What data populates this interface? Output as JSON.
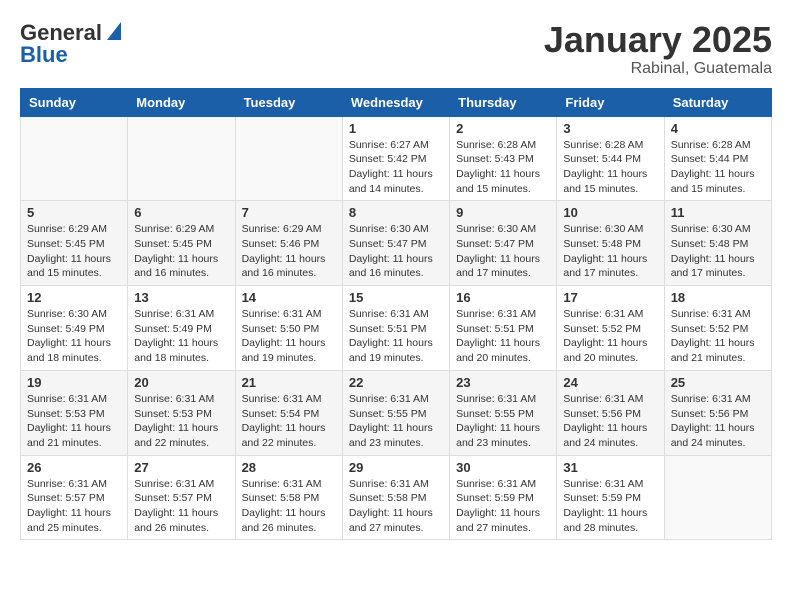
{
  "header": {
    "logo_general": "General",
    "logo_blue": "Blue",
    "month_title": "January 2025",
    "location": "Rabinal, Guatemala"
  },
  "weekdays": [
    "Sunday",
    "Monday",
    "Tuesday",
    "Wednesday",
    "Thursday",
    "Friday",
    "Saturday"
  ],
  "weeks": [
    [
      {
        "day": "",
        "info": ""
      },
      {
        "day": "",
        "info": ""
      },
      {
        "day": "",
        "info": ""
      },
      {
        "day": "1",
        "info": "Sunrise: 6:27 AM\nSunset: 5:42 PM\nDaylight: 11 hours\nand 14 minutes."
      },
      {
        "day": "2",
        "info": "Sunrise: 6:28 AM\nSunset: 5:43 PM\nDaylight: 11 hours\nand 15 minutes."
      },
      {
        "day": "3",
        "info": "Sunrise: 6:28 AM\nSunset: 5:44 PM\nDaylight: 11 hours\nand 15 minutes."
      },
      {
        "day": "4",
        "info": "Sunrise: 6:28 AM\nSunset: 5:44 PM\nDaylight: 11 hours\nand 15 minutes."
      }
    ],
    [
      {
        "day": "5",
        "info": "Sunrise: 6:29 AM\nSunset: 5:45 PM\nDaylight: 11 hours\nand 15 minutes."
      },
      {
        "day": "6",
        "info": "Sunrise: 6:29 AM\nSunset: 5:45 PM\nDaylight: 11 hours\nand 16 minutes."
      },
      {
        "day": "7",
        "info": "Sunrise: 6:29 AM\nSunset: 5:46 PM\nDaylight: 11 hours\nand 16 minutes."
      },
      {
        "day": "8",
        "info": "Sunrise: 6:30 AM\nSunset: 5:47 PM\nDaylight: 11 hours\nand 16 minutes."
      },
      {
        "day": "9",
        "info": "Sunrise: 6:30 AM\nSunset: 5:47 PM\nDaylight: 11 hours\nand 17 minutes."
      },
      {
        "day": "10",
        "info": "Sunrise: 6:30 AM\nSunset: 5:48 PM\nDaylight: 11 hours\nand 17 minutes."
      },
      {
        "day": "11",
        "info": "Sunrise: 6:30 AM\nSunset: 5:48 PM\nDaylight: 11 hours\nand 17 minutes."
      }
    ],
    [
      {
        "day": "12",
        "info": "Sunrise: 6:30 AM\nSunset: 5:49 PM\nDaylight: 11 hours\nand 18 minutes."
      },
      {
        "day": "13",
        "info": "Sunrise: 6:31 AM\nSunset: 5:49 PM\nDaylight: 11 hours\nand 18 minutes."
      },
      {
        "day": "14",
        "info": "Sunrise: 6:31 AM\nSunset: 5:50 PM\nDaylight: 11 hours\nand 19 minutes."
      },
      {
        "day": "15",
        "info": "Sunrise: 6:31 AM\nSunset: 5:51 PM\nDaylight: 11 hours\nand 19 minutes."
      },
      {
        "day": "16",
        "info": "Sunrise: 6:31 AM\nSunset: 5:51 PM\nDaylight: 11 hours\nand 20 minutes."
      },
      {
        "day": "17",
        "info": "Sunrise: 6:31 AM\nSunset: 5:52 PM\nDaylight: 11 hours\nand 20 minutes."
      },
      {
        "day": "18",
        "info": "Sunrise: 6:31 AM\nSunset: 5:52 PM\nDaylight: 11 hours\nand 21 minutes."
      }
    ],
    [
      {
        "day": "19",
        "info": "Sunrise: 6:31 AM\nSunset: 5:53 PM\nDaylight: 11 hours\nand 21 minutes."
      },
      {
        "day": "20",
        "info": "Sunrise: 6:31 AM\nSunset: 5:53 PM\nDaylight: 11 hours\nand 22 minutes."
      },
      {
        "day": "21",
        "info": "Sunrise: 6:31 AM\nSunset: 5:54 PM\nDaylight: 11 hours\nand 22 minutes."
      },
      {
        "day": "22",
        "info": "Sunrise: 6:31 AM\nSunset: 5:55 PM\nDaylight: 11 hours\nand 23 minutes."
      },
      {
        "day": "23",
        "info": "Sunrise: 6:31 AM\nSunset: 5:55 PM\nDaylight: 11 hours\nand 23 minutes."
      },
      {
        "day": "24",
        "info": "Sunrise: 6:31 AM\nSunset: 5:56 PM\nDaylight: 11 hours\nand 24 minutes."
      },
      {
        "day": "25",
        "info": "Sunrise: 6:31 AM\nSunset: 5:56 PM\nDaylight: 11 hours\nand 24 minutes."
      }
    ],
    [
      {
        "day": "26",
        "info": "Sunrise: 6:31 AM\nSunset: 5:57 PM\nDaylight: 11 hours\nand 25 minutes."
      },
      {
        "day": "27",
        "info": "Sunrise: 6:31 AM\nSunset: 5:57 PM\nDaylight: 11 hours\nand 26 minutes."
      },
      {
        "day": "28",
        "info": "Sunrise: 6:31 AM\nSunset: 5:58 PM\nDaylight: 11 hours\nand 26 minutes."
      },
      {
        "day": "29",
        "info": "Sunrise: 6:31 AM\nSunset: 5:58 PM\nDaylight: 11 hours\nand 27 minutes."
      },
      {
        "day": "30",
        "info": "Sunrise: 6:31 AM\nSunset: 5:59 PM\nDaylight: 11 hours\nand 27 minutes."
      },
      {
        "day": "31",
        "info": "Sunrise: 6:31 AM\nSunset: 5:59 PM\nDaylight: 11 hours\nand 28 minutes."
      },
      {
        "day": "",
        "info": ""
      }
    ]
  ]
}
